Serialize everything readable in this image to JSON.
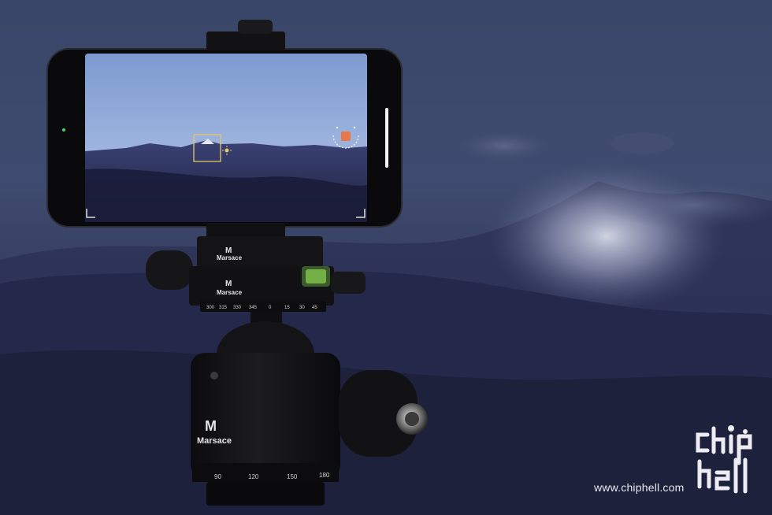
{
  "photo": {
    "brand_top": "Marsace",
    "brand_middle": "Marsace",
    "brand_ballhead": "Marsace",
    "scale_upper": [
      "300",
      "315",
      "330",
      "345",
      "0",
      "15",
      "30",
      "45"
    ],
    "scale_lower": [
      "90",
      "120",
      "150",
      "180"
    ]
  },
  "watermark": {
    "logo_text": "chiphell",
    "url": "www.chiphell.com"
  },
  "colors": {
    "sky_top": "#3a4668",
    "sky_bottom": "#1d2036",
    "record_button": "#e8774a",
    "focus_box": "#e6c46a"
  }
}
